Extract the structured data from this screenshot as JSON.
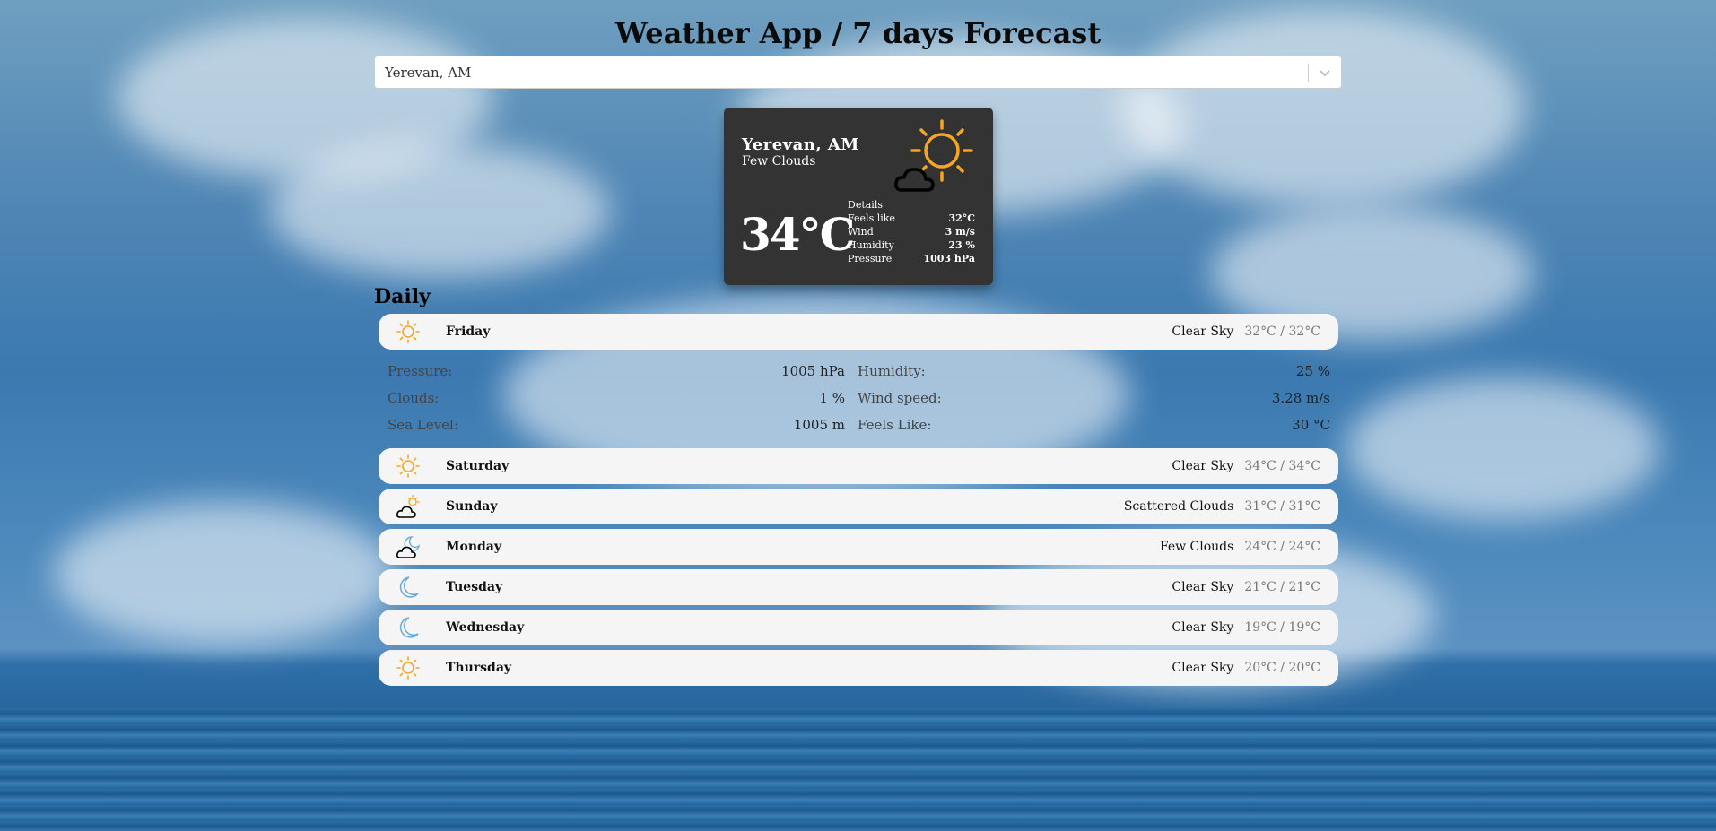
{
  "app": {
    "title": "Weather App / 7 days Forecast"
  },
  "search": {
    "value": "Yerevan, AM",
    "icon": "chevron-down-icon"
  },
  "current": {
    "city": "Yerevan, AM",
    "description": "Few Clouds",
    "temp": "34°C",
    "icon": "sun-cloud-icon",
    "details_title": "Details",
    "details": [
      {
        "label": "Feels like",
        "value": "32°C"
      },
      {
        "label": "Wind",
        "value": "3 m/s"
      },
      {
        "label": "Humidity",
        "value": "23 %"
      },
      {
        "label": "Pressure",
        "value": "1003 hPa"
      }
    ]
  },
  "daily": {
    "heading": "Daily",
    "days": [
      {
        "name": "Friday",
        "desc": "Clear Sky",
        "minmax": "32°C / 32°C",
        "icon": "sun-icon"
      },
      {
        "name": "Saturday",
        "desc": "Clear Sky",
        "minmax": "34°C / 34°C",
        "icon": "sun-icon"
      },
      {
        "name": "Sunday",
        "desc": "Scattered Clouds",
        "minmax": "31°C / 31°C",
        "icon": "cloud-sun-icon"
      },
      {
        "name": "Monday",
        "desc": "Few Clouds",
        "minmax": "24°C / 24°C",
        "icon": "cloud-moon-icon"
      },
      {
        "name": "Tuesday",
        "desc": "Clear Sky",
        "minmax": "21°C / 21°C",
        "icon": "moon-icon"
      },
      {
        "name": "Wednesday",
        "desc": "Clear Sky",
        "minmax": "19°C / 19°C",
        "icon": "moon-icon"
      },
      {
        "name": "Thursday",
        "desc": "Clear Sky",
        "minmax": "20°C / 20°C",
        "icon": "sun-icon"
      }
    ],
    "expanded": {
      "left": [
        {
          "label": "Pressure:",
          "value": "1005 hPa"
        },
        {
          "label": "Clouds:",
          "value": "1 %"
        },
        {
          "label": "Sea Level:",
          "value": "1005 m"
        }
      ],
      "right": [
        {
          "label": "Humidity:",
          "value": "25 %"
        },
        {
          "label": "Wind speed:",
          "value": "3.28 m/s"
        },
        {
          "label": "Feels Like:",
          "value": "30 °C"
        }
      ]
    }
  },
  "colors": {
    "sun": "#f5a623",
    "moon": "#6aa9d8",
    "card_bg": "#333333",
    "row_bg": "#f5f5f5"
  }
}
